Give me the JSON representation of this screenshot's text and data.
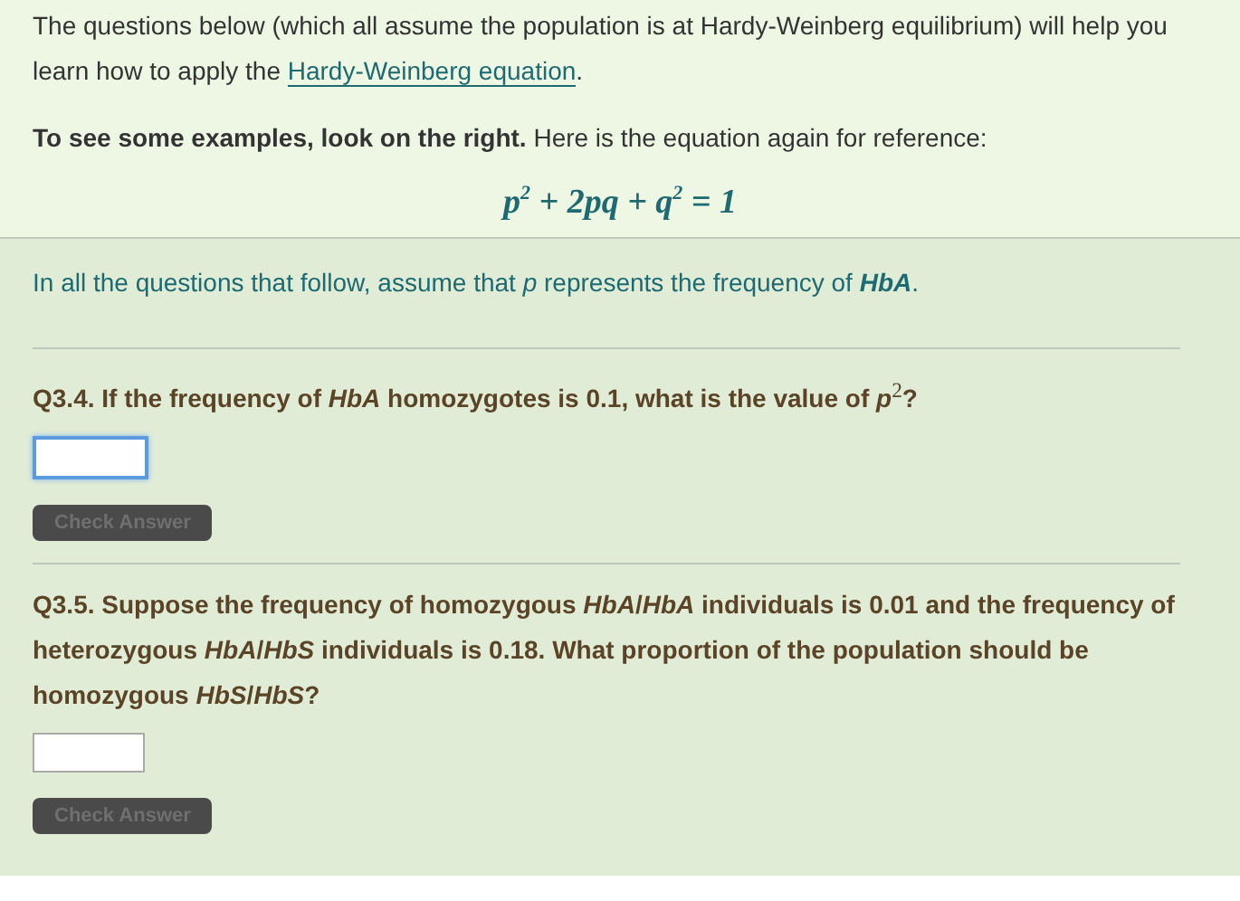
{
  "intro": {
    "before": "The questions below (which all assume the population is at Hardy-Weinberg equilibrium) will help you learn how to apply the ",
    "link": "Hardy-Weinberg equation",
    "after": "."
  },
  "examples_note": "**To see some examples, look on the right.** Here is the equation again for reference:",
  "equation": "p$^{2}$ + 2pq + q$^{2}$ = 1",
  "assumption": "In all the questions that follow, assume that *p* represents the frequency of **HbA**.",
  "questions": [
    {
      "text": "Q3.4. If the frequency of *HbA* homozygotes is 0.1, what is the value of *p*$^{2}$?",
      "answer": {
        "focused": true
      },
      "button": {
        "label": "Check Answer",
        "disabled": true
      }
    },
    {
      "text": "Q3.5. Suppose the frequency of homozygous *HbA*/*HbA* individuals is 0.01 and the frequency of heterozygous *HbA*/*HbS* individuals is 0.18. What proportion of the population should be homozygous *HbS*/*HbS*?",
      "answer": {
        "focused": false
      },
      "button": {
        "label": "Check Answer",
        "disabled": true
      }
    }
  ]
}
